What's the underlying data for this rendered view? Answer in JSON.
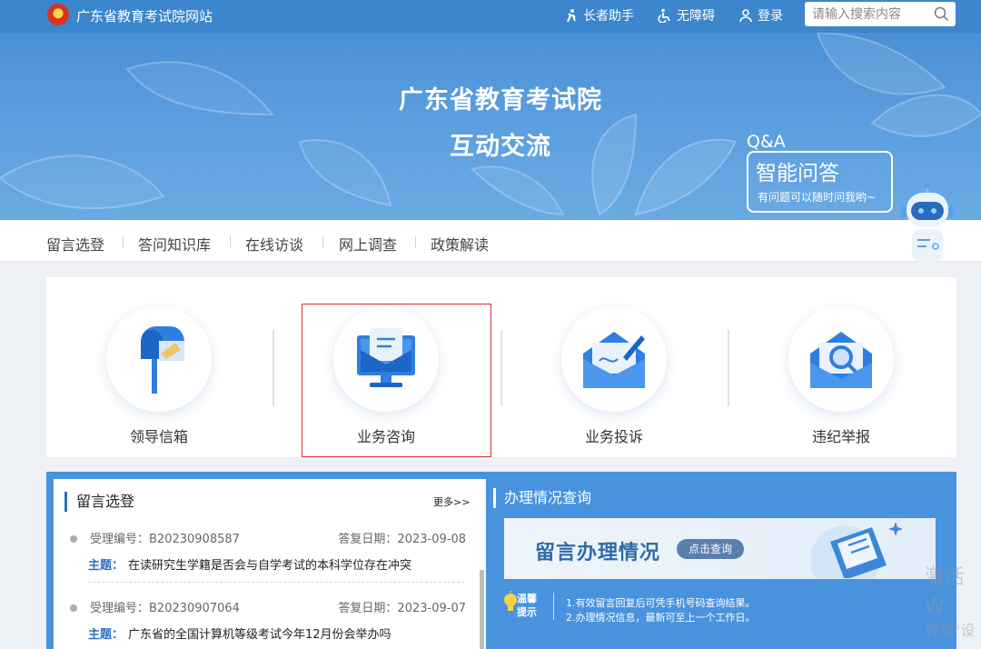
{
  "header": {
    "site_name": "广东省教育考试院网站",
    "links": [
      {
        "label": "长者助手",
        "icon": "elderly-icon"
      },
      {
        "label": "无障碍",
        "icon": "accessibility-icon"
      },
      {
        "label": "登录",
        "icon": "user-icon"
      }
    ],
    "search_placeholder": "请输入搜索内容"
  },
  "banner": {
    "title_line1": "广东省教育考试院",
    "title_line2": "互动交流",
    "qa_label": "Q&A",
    "qa_title": "智能问答",
    "qa_subtitle": "有问题可以随时问我哟~"
  },
  "subnav": {
    "items": [
      "留言选登",
      "答问知识库",
      "在线访谈",
      "网上调查",
      "政策解读"
    ]
  },
  "services": [
    {
      "label": "领导信箱",
      "icon": "mailbox-icon"
    },
    {
      "label": "业务咨询",
      "icon": "computer-mail-icon"
    },
    {
      "label": "业务投诉",
      "icon": "envelope-pen-icon"
    },
    {
      "label": "违纪举报",
      "icon": "envelope-search-icon"
    }
  ],
  "messages": {
    "title": "留言选登",
    "more": "更多>>",
    "id_label": "受理编号：",
    "date_label": "答复日期：",
    "topic_label": "主题：",
    "items": [
      {
        "id": "B20230908587",
        "date": "2023-09-08",
        "topic": "在读研究生学籍是否会与自学考试的本科学位存在冲突"
      },
      {
        "id": "B20230907064",
        "date": "2023-09-07",
        "topic": "广东省的全国计算机等级考试今年12月份会举办吗"
      }
    ]
  },
  "status": {
    "title": "办理情况查询",
    "card_title": "留言办理情况",
    "button": "点击查询",
    "tips_label": "温馨提示",
    "tips": [
      "1.有效留言回复后可凭手机号码查询结果。",
      "2.办理情况信息，最新可至上一个工作日。"
    ]
  },
  "watermark": {
    "line1": "激活 W",
    "line2": "转到\"设"
  },
  "colors": {
    "primary": "#3b86cd",
    "accent_red": "#d9313b",
    "panel_blue": "#4993de"
  }
}
